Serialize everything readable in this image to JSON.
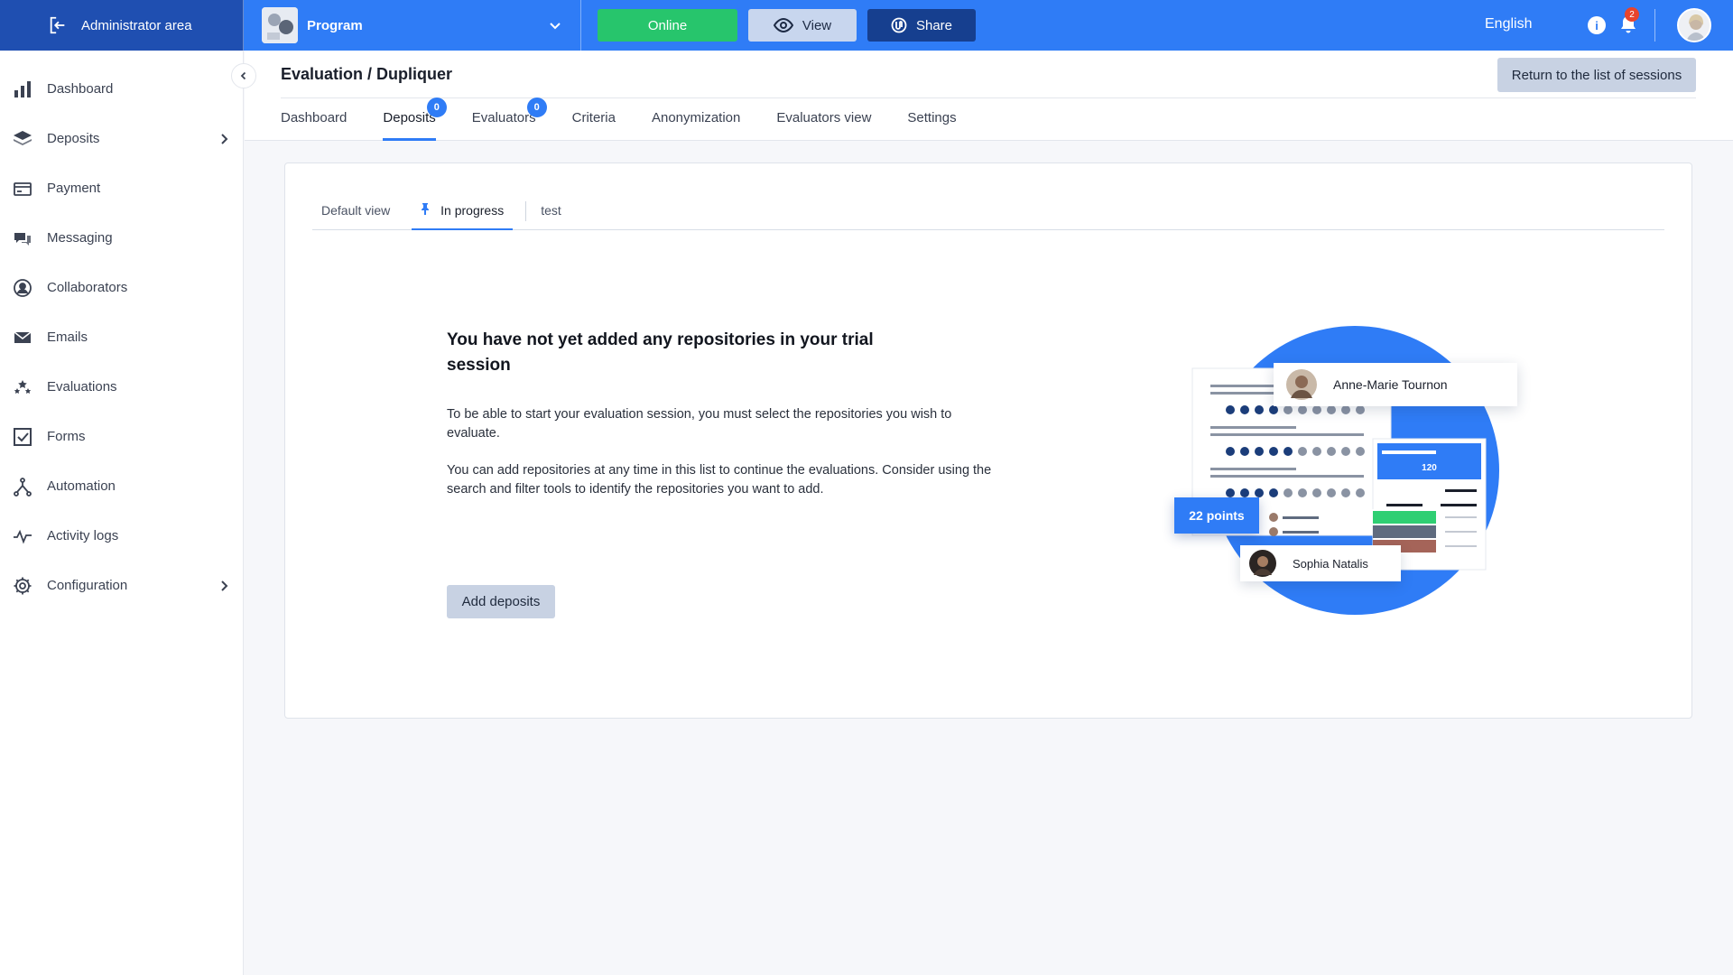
{
  "topbar": {
    "admin_area": "Administrator area",
    "program": "Program",
    "online": "Online",
    "view": "View",
    "share": "Share",
    "language": "English",
    "notifications_count": "2",
    "info_icon_glyph": "i"
  },
  "sidebar": {
    "items": [
      {
        "label": "Dashboard",
        "icon": "bar-chart-icon"
      },
      {
        "label": "Deposits",
        "icon": "layers-icon"
      },
      {
        "label": "Payment",
        "icon": "credit-card-icon"
      },
      {
        "label": "Messaging",
        "icon": "chat-bubbles-icon"
      },
      {
        "label": "Collaborators",
        "icon": "user-circle-icon"
      },
      {
        "label": "Emails",
        "icon": "envelope-icon"
      },
      {
        "label": "Evaluations",
        "icon": "stars-icon"
      },
      {
        "label": "Forms",
        "icon": "checkbox-icon"
      },
      {
        "label": "Automation",
        "icon": "automation-icon"
      },
      {
        "label": "Activity logs",
        "icon": "pulse-icon"
      },
      {
        "label": "Configuration",
        "icon": "gear-icon"
      }
    ]
  },
  "header": {
    "title": "Evaluation / Dupliquer",
    "return_label": "Return to the list of sessions",
    "tabs": [
      {
        "label": "Dashboard"
      },
      {
        "label": "Deposits",
        "badge": "0"
      },
      {
        "label": "Evaluators",
        "badge": "0"
      },
      {
        "label": "Criteria"
      },
      {
        "label": "Anonymization"
      },
      {
        "label": "Evaluators view"
      },
      {
        "label": "Settings"
      }
    ]
  },
  "views": {
    "tabs": [
      {
        "label": "Default view"
      },
      {
        "label": "In progress"
      },
      {
        "label": "test"
      }
    ]
  },
  "empty_state": {
    "title": "You have not yet added any repositories in your trial session",
    "paragraph1": "To be able to start your evaluation session, you must select the repositories you wish to evaluate.",
    "paragraph2": "You can add repositories at any time in this list to continue the evaluations. Consider using the search and filter tools to identify the repositories you want to add.",
    "add_button": "Add deposits"
  },
  "illustration": {
    "person1": "Anne-Marie Tournon",
    "person2": "Sophia Natalis",
    "points": "22 points",
    "score": "120",
    "colors": {
      "circle": "#2f7cf6",
      "green": "#2fcf73",
      "gray": "#5f6b7f",
      "brown": "#a56459"
    }
  },
  "colors": {
    "primary": "#2f7cf6",
    "admin_bg": "#1f4fb1",
    "online": "#27c56c",
    "share": "#163f8f"
  }
}
